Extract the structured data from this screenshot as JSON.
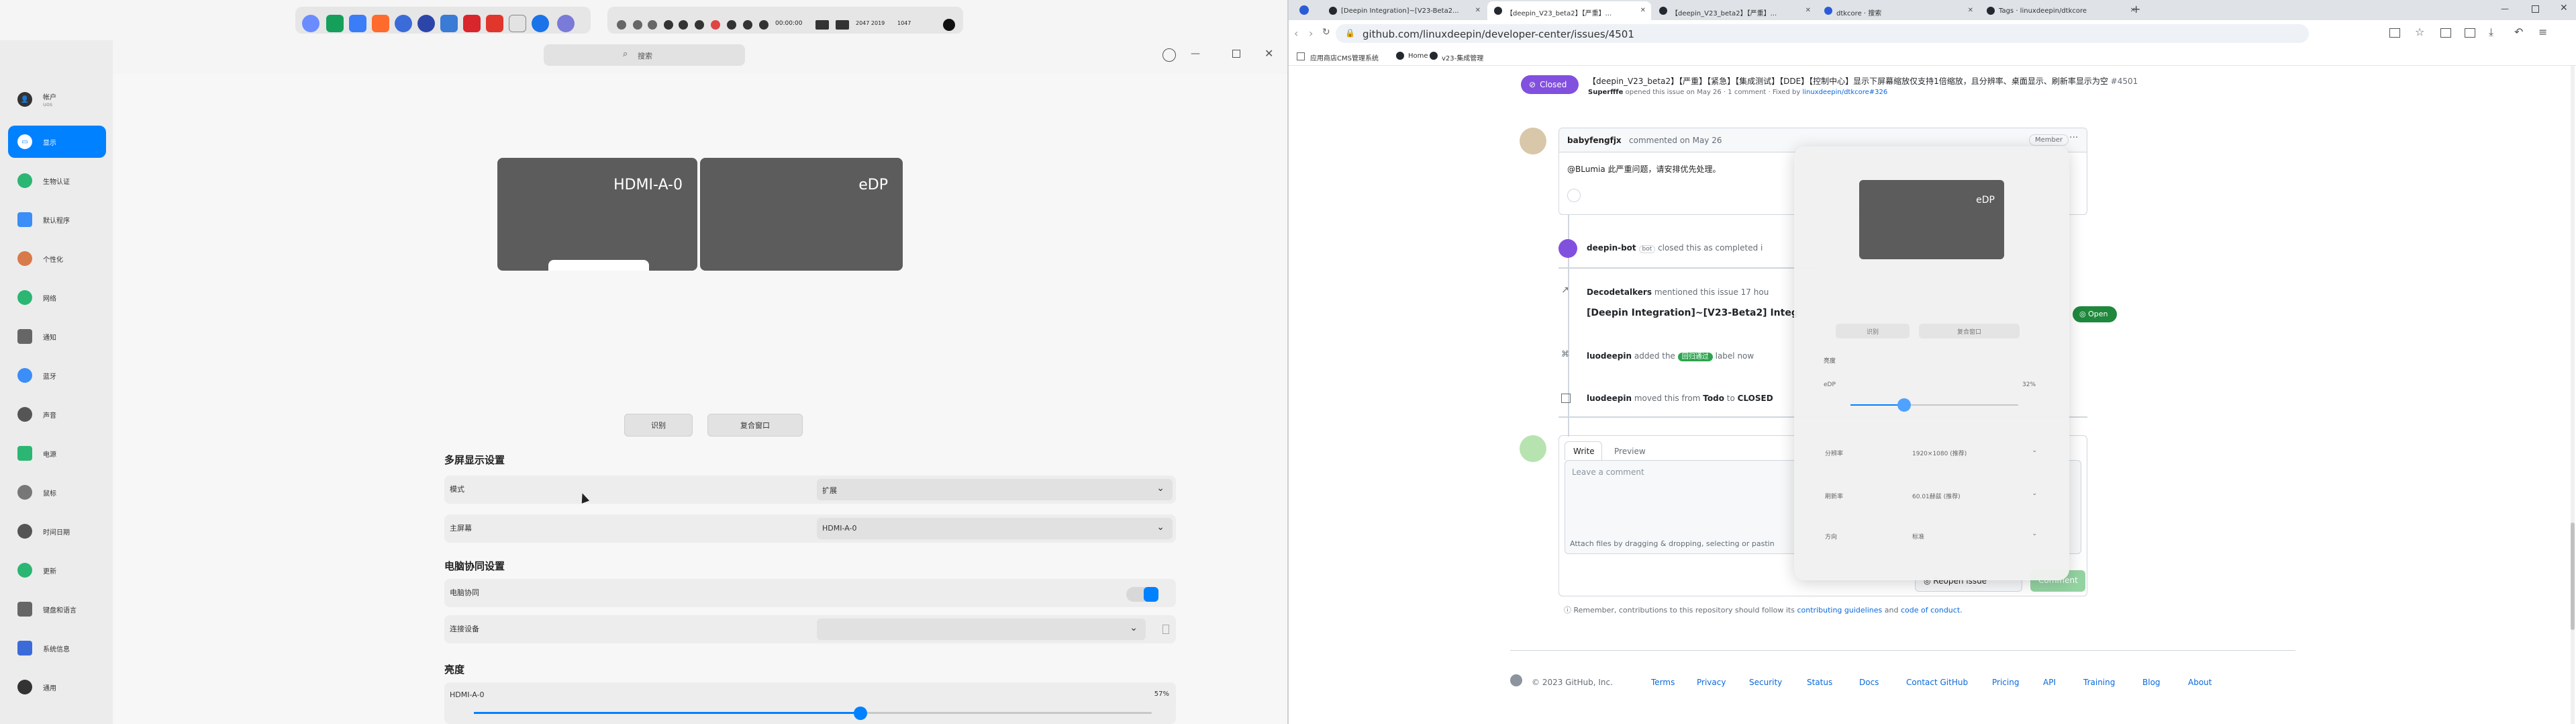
{
  "dock": {
    "clock": "00:00:00",
    "date": "2047 2019",
    "indicator": "1047"
  },
  "control_center": {
    "search_placeholder": "搜索",
    "sidebar": [
      {
        "label": "帐户",
        "sub": "uos"
      },
      {
        "label": "显示"
      },
      {
        "label": "生物认证"
      },
      {
        "label": "默认程序"
      },
      {
        "label": "个性化"
      },
      {
        "label": "网络"
      },
      {
        "label": "通知"
      },
      {
        "label": "蓝牙"
      },
      {
        "label": "声音"
      },
      {
        "label": "电源"
      },
      {
        "label": "鼠标"
      },
      {
        "label": "时间日期"
      },
      {
        "label": "更新"
      },
      {
        "label": "键盘和语言"
      },
      {
        "label": "系统信息"
      },
      {
        "label": "通用"
      }
    ],
    "monitors": [
      {
        "name": "HDMI-A-0"
      },
      {
        "name": "eDP"
      }
    ],
    "buttons": {
      "identify": "识别",
      "merge": "复合窗口"
    },
    "multi_display_title": "多屏显示设置",
    "mode_label": "模式",
    "mode_value": "扩展",
    "primary_label": "主屏幕",
    "primary_value": "HDMI-A-0",
    "collab_title": "电脑协同设置",
    "collab_label": "电脑协同",
    "device_label": "连接设备",
    "brightness_title": "亮度",
    "brightness_monitor": "HDMI-A-0",
    "brightness_value": "57%",
    "brightness_fraction": 0.57
  },
  "browser": {
    "tabs": [
      {
        "title": "[Deepin Integration]~[V23-Beta2..."
      },
      {
        "title": "【deepin_V23_beta2】【严重】..."
      },
      {
        "title": "【deepin_V23_beta2】【严重】..."
      },
      {
        "title": "dtkcore · 搜索"
      },
      {
        "title": "Tags · linuxdeepin/dtkcore"
      }
    ],
    "url": "github.com/linuxdeepin/developer-center/issues/4501",
    "bookmarks": {
      "b1": "应用商店CMS管理系统",
      "b2": "Home",
      "b3": "v23-集成管理"
    },
    "issue": {
      "status": "Closed",
      "title": "【deepin_V23_beta2】【严重】【紧急】【集成测试】【DDE】【控制中心】显示下屏幕缩放仅支持1倍缩放，且分辨率、桌面显示、刷新率显示为空",
      "number": "#4501",
      "meta_user": "Superfffe",
      "meta_text": "opened this issue on May 26 · 1 comment · Fixed by",
      "fixed_by": "linuxdeepin/dtkcore#326"
    },
    "comment": {
      "author": "babyfengfjx",
      "date": "commented on May 26",
      "badge": "Member",
      "body": "@BLumia 此严重问题，请安排优先处理。"
    },
    "events": [
      {
        "user": "deepin-bot",
        "tag": "bot",
        "text": "closed this as completed i"
      },
      {
        "user": "Decodetalkers",
        "text": "mentioned this issue 17 hou"
      },
      {
        "user": "luodeepin",
        "text": "added the",
        "label": "回归通过",
        "after": "label now"
      },
      {
        "user": "luodeepin",
        "text": "moved this from",
        "from": "Todo",
        "to": "CLOSED"
      }
    ],
    "ref_issue": "[Deepin Integration]~[V23-Beta2] Integ",
    "ref_status": "Open",
    "editor": {
      "write_tab": "Write",
      "preview_tab": "Preview",
      "placeholder": "Leave a comment",
      "attach": "Attach files by dragging & dropping, selecting or pastin",
      "reopen": "Reopen issue",
      "comment": "Comment",
      "note_prefix": "Remember, contributions to this repository should follow its",
      "guidelines": "contributing guidelines",
      "and": "and",
      "coc": "code of conduct."
    },
    "footer": {
      "copyright": "© 2023 GitHub, Inc.",
      "links": [
        "Terms",
        "Privacy",
        "Security",
        "Status",
        "Docs",
        "Contact GitHub",
        "Pricing",
        "API",
        "Training",
        "Blog",
        "About"
      ]
    }
  },
  "popup": {
    "monitor": "eDP",
    "identify": "识别",
    "merge": "复合窗口",
    "brightness_title": "亮度",
    "brightness_name": "eDP",
    "brightness_value": "32%",
    "brightness_fraction": 0.32,
    "resolution_label": "分辨率",
    "resolution_value": "1920×1080 (推荐)",
    "refresh_label": "刷新率",
    "refresh_value": "60.01赫兹 (推荐)",
    "orientation_label": "方向",
    "orientation_value": "标准"
  },
  "colors": {
    "accent": "#0081ff",
    "closed": "#8250df",
    "open": "#1f883d",
    "link": "#0969da"
  }
}
